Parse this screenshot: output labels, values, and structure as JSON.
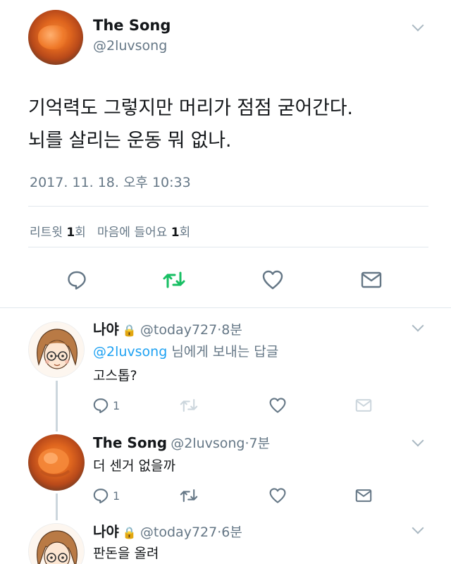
{
  "main_tweet": {
    "name": "The Song",
    "handle": "@2luvsong",
    "text_line1": "기억력도 그렇지만 머리가 점점 굳어간다.",
    "text_line2": "뇌를 살리는 운동 뭐 없나.",
    "timestamp": "2017. 11. 18. 오후 10:33",
    "retweet_label": "리트윗",
    "retweet_count": "1",
    "retweet_unit": "회",
    "like_label": "마음에 들어요",
    "like_count": "1",
    "like_unit": "회",
    "actions": {
      "reply_icon": "reply-bubble-icon",
      "retweet_icon": "retweet-icon",
      "like_icon": "heart-icon",
      "dm_icon": "envelope-icon"
    }
  },
  "colors": {
    "retweet_accent": "#17bf63",
    "mention": "#1da1f2",
    "muted": "#657786"
  },
  "replies": [
    {
      "name": "나야",
      "lock": "🔒",
      "handle": "@today727",
      "sep": "·",
      "time": "8분",
      "reply_to_mention": "@2luvsong",
      "reply_to_suffix": " 님에게 보내는 답글",
      "text": "고스톱?",
      "reply_count": "1"
    },
    {
      "name": "The Song",
      "handle": "@2luvsong",
      "sep": "·",
      "time": "7분",
      "text": "더 센거 없을까",
      "reply_count": "1"
    },
    {
      "name": "나야",
      "lock": "🔒",
      "handle": "@today727",
      "sep": "·",
      "time": "6분",
      "text": "판돈을 올려"
    }
  ]
}
